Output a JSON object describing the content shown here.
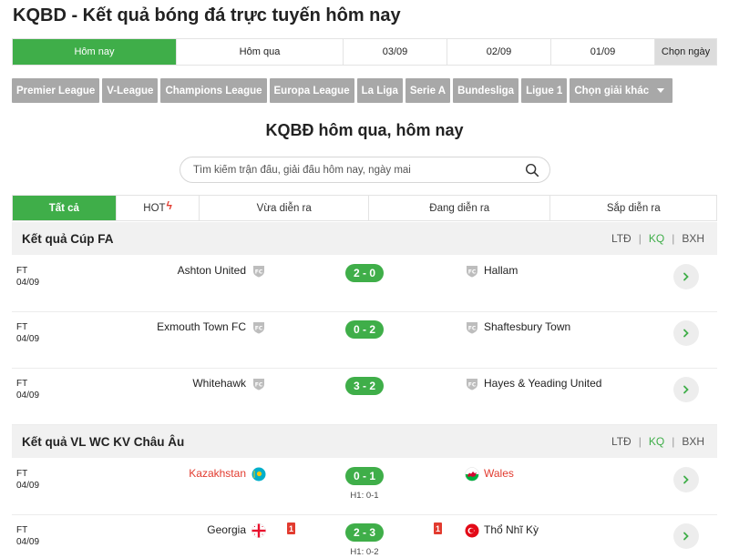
{
  "page": {
    "title": "KQBD - Kết quả bóng đá trực tuyến hôm nay"
  },
  "date_tabs": [
    {
      "label": "Hôm nay"
    },
    {
      "label": "Hôm qua"
    },
    {
      "label": "03/09"
    },
    {
      "label": "02/09"
    },
    {
      "label": "01/09"
    },
    {
      "label": "Chọn ngày"
    }
  ],
  "leagues": [
    {
      "label": "Premier League"
    },
    {
      "label": "V-League"
    },
    {
      "label": "Champions League"
    },
    {
      "label": "Europa League"
    },
    {
      "label": "La Liga"
    },
    {
      "label": "Serie A"
    },
    {
      "label": "Bundesliga"
    },
    {
      "label": "Ligue 1"
    },
    {
      "label": "Chọn giải khác"
    }
  ],
  "main": {
    "title": "KQBĐ hôm qua, hôm nay",
    "search_placeholder": "Tìm kiếm trận đấu, giải đấu hôm nay, ngày mai"
  },
  "filters": [
    {
      "label": "Tất cả"
    },
    {
      "label": "HOT"
    },
    {
      "label": "Vừa diễn ra"
    },
    {
      "label": "Đang diễn ra"
    },
    {
      "label": "Sắp diễn ra"
    }
  ],
  "comp_links": {
    "schedule": "LTĐ",
    "results": "KQ",
    "standings": "BXH"
  },
  "competitions": [
    {
      "title": "Kết quả Cúp FA",
      "matches": [
        {
          "status": "FT",
          "date": "04/09",
          "home": "Ashton United",
          "score": "2 - 0",
          "away": "Hallam"
        },
        {
          "status": "FT",
          "date": "04/09",
          "home": "Exmouth Town FC",
          "score": "0 - 2",
          "away": "Shaftesbury Town"
        },
        {
          "status": "FT",
          "date": "04/09",
          "home": "Whitehawk",
          "score": "3 - 2",
          "away": "Hayes & Yeading United"
        }
      ]
    },
    {
      "title": "Kết quả VL WC KV Châu Âu",
      "matches": [
        {
          "status": "FT",
          "date": "04/09",
          "home": "Kazakhstan",
          "score": "0 - 1",
          "away": "Wales",
          "ht": "H1: 0-1"
        },
        {
          "status": "FT",
          "date": "04/09",
          "home": "Georgia",
          "home_cards": "1",
          "score": "2 - 3",
          "away_cards": "1",
          "away": "Thổ Nhĩ Kỳ",
          "ht": "H1: 0-2"
        }
      ]
    }
  ],
  "colors": {
    "accent": "#3fae49",
    "league_bg": "#a8a8a8",
    "red": "#e23b2f"
  }
}
